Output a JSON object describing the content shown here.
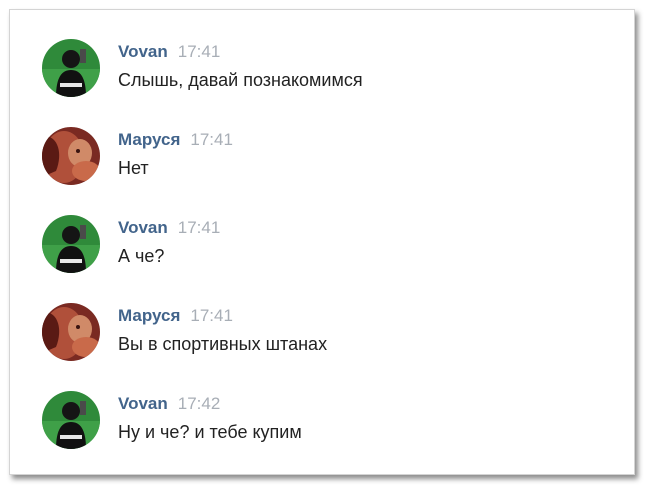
{
  "chat": {
    "messages": [
      {
        "author": "Vovan",
        "time": "17:41",
        "text": "Слышь, давай познакомимся",
        "avatar_icon": "user-avatar-vovan-icon"
      },
      {
        "author": "Маруся",
        "time": "17:41",
        "text": "Нет",
        "avatar_icon": "user-avatar-marusya-icon"
      },
      {
        "author": "Vovan",
        "time": "17:41",
        "text": "А че?",
        "avatar_icon": "user-avatar-vovan-icon"
      },
      {
        "author": "Маруся",
        "time": "17:41",
        "text": "Вы в спортивных штанах",
        "avatar_icon": "user-avatar-marusya-icon"
      },
      {
        "author": "Vovan",
        "time": "17:42",
        "text": "Ну и че? и тебе купим",
        "avatar_icon": "user-avatar-vovan-icon"
      }
    ]
  },
  "colors": {
    "author_link": "#42648b",
    "timestamp": "#a8aeb6",
    "message_text": "#222222",
    "vovan_avatar_bg": "#2f8a3a",
    "marusya_avatar_bg": "#7a2a22"
  }
}
